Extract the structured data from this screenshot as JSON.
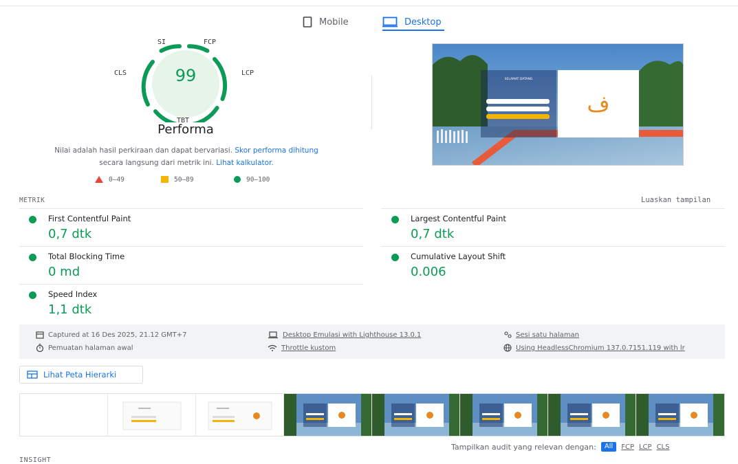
{
  "tabs": {
    "mobile": "Mobile",
    "desktop": "Desktop"
  },
  "gauge": {
    "score": "99",
    "labels": {
      "si": "SI",
      "fcp": "FCP",
      "lcp": "LCP",
      "cls": "CLS",
      "tbt": "TBT"
    },
    "title": "Performa",
    "note_prefix": "Nilai adalah hasil perkiraan dan dapat bervariasi.",
    "note_link1": "Skor performa dihitung",
    "note_middle": "secara langsung dari metrik ini.",
    "note_link2": "Lihat kalkulator."
  },
  "legend": {
    "poor": "0–49",
    "average": "50–89",
    "good": "90–100"
  },
  "metrics_section": {
    "label": "METRIK",
    "expand": "Luaskan tampilan"
  },
  "metrics": {
    "fcp": {
      "name": "First Contentful Paint",
      "value": "0,7 dtk"
    },
    "lcp": {
      "name": "Largest Contentful Paint",
      "value": "0,7 dtk"
    },
    "tbt": {
      "name": "Total Blocking Time",
      "value": "0 md"
    },
    "cls": {
      "name": "Cumulative Layout Shift",
      "value": "0.006"
    },
    "si": {
      "name": "Speed Index",
      "value": "1,1 dtk"
    }
  },
  "info": {
    "captured": "Captured at 16 Des 2025, 21.12 GMT+7",
    "load": "Pemuatan halaman awal",
    "emulation": "Desktop Emulasi with Lighthouse 13.0.1",
    "throttle": "Throttle kustom",
    "session": "Sesi satu halaman",
    "browser": "Using HeadlessChromium 137.0.7151.119 with lr"
  },
  "tree_button": "Lihat Peta Hierarki",
  "filter": {
    "label": "Tampilkan audit yang relevan dengan:",
    "all": "All",
    "fcp": "FCP",
    "lcp": "LCP",
    "cls": "CLS"
  },
  "insight_label": "INSIGHT",
  "screenshot": {
    "welcome": "SELAMAT DATANG",
    "logo_text": "ف"
  },
  "colors": {
    "good": "#0c9b57",
    "average": "#f4b400",
    "poor": "#e8453c",
    "accent": "#1a73e8"
  },
  "icons": {
    "mobile": "phone-icon",
    "desktop": "monitor-icon",
    "calendar": "calendar-icon",
    "timer": "stopwatch-icon",
    "device": "laptop-icon",
    "network": "wifi-icon",
    "users": "users-icon",
    "globe": "globe-icon",
    "tree": "treemap-icon"
  }
}
